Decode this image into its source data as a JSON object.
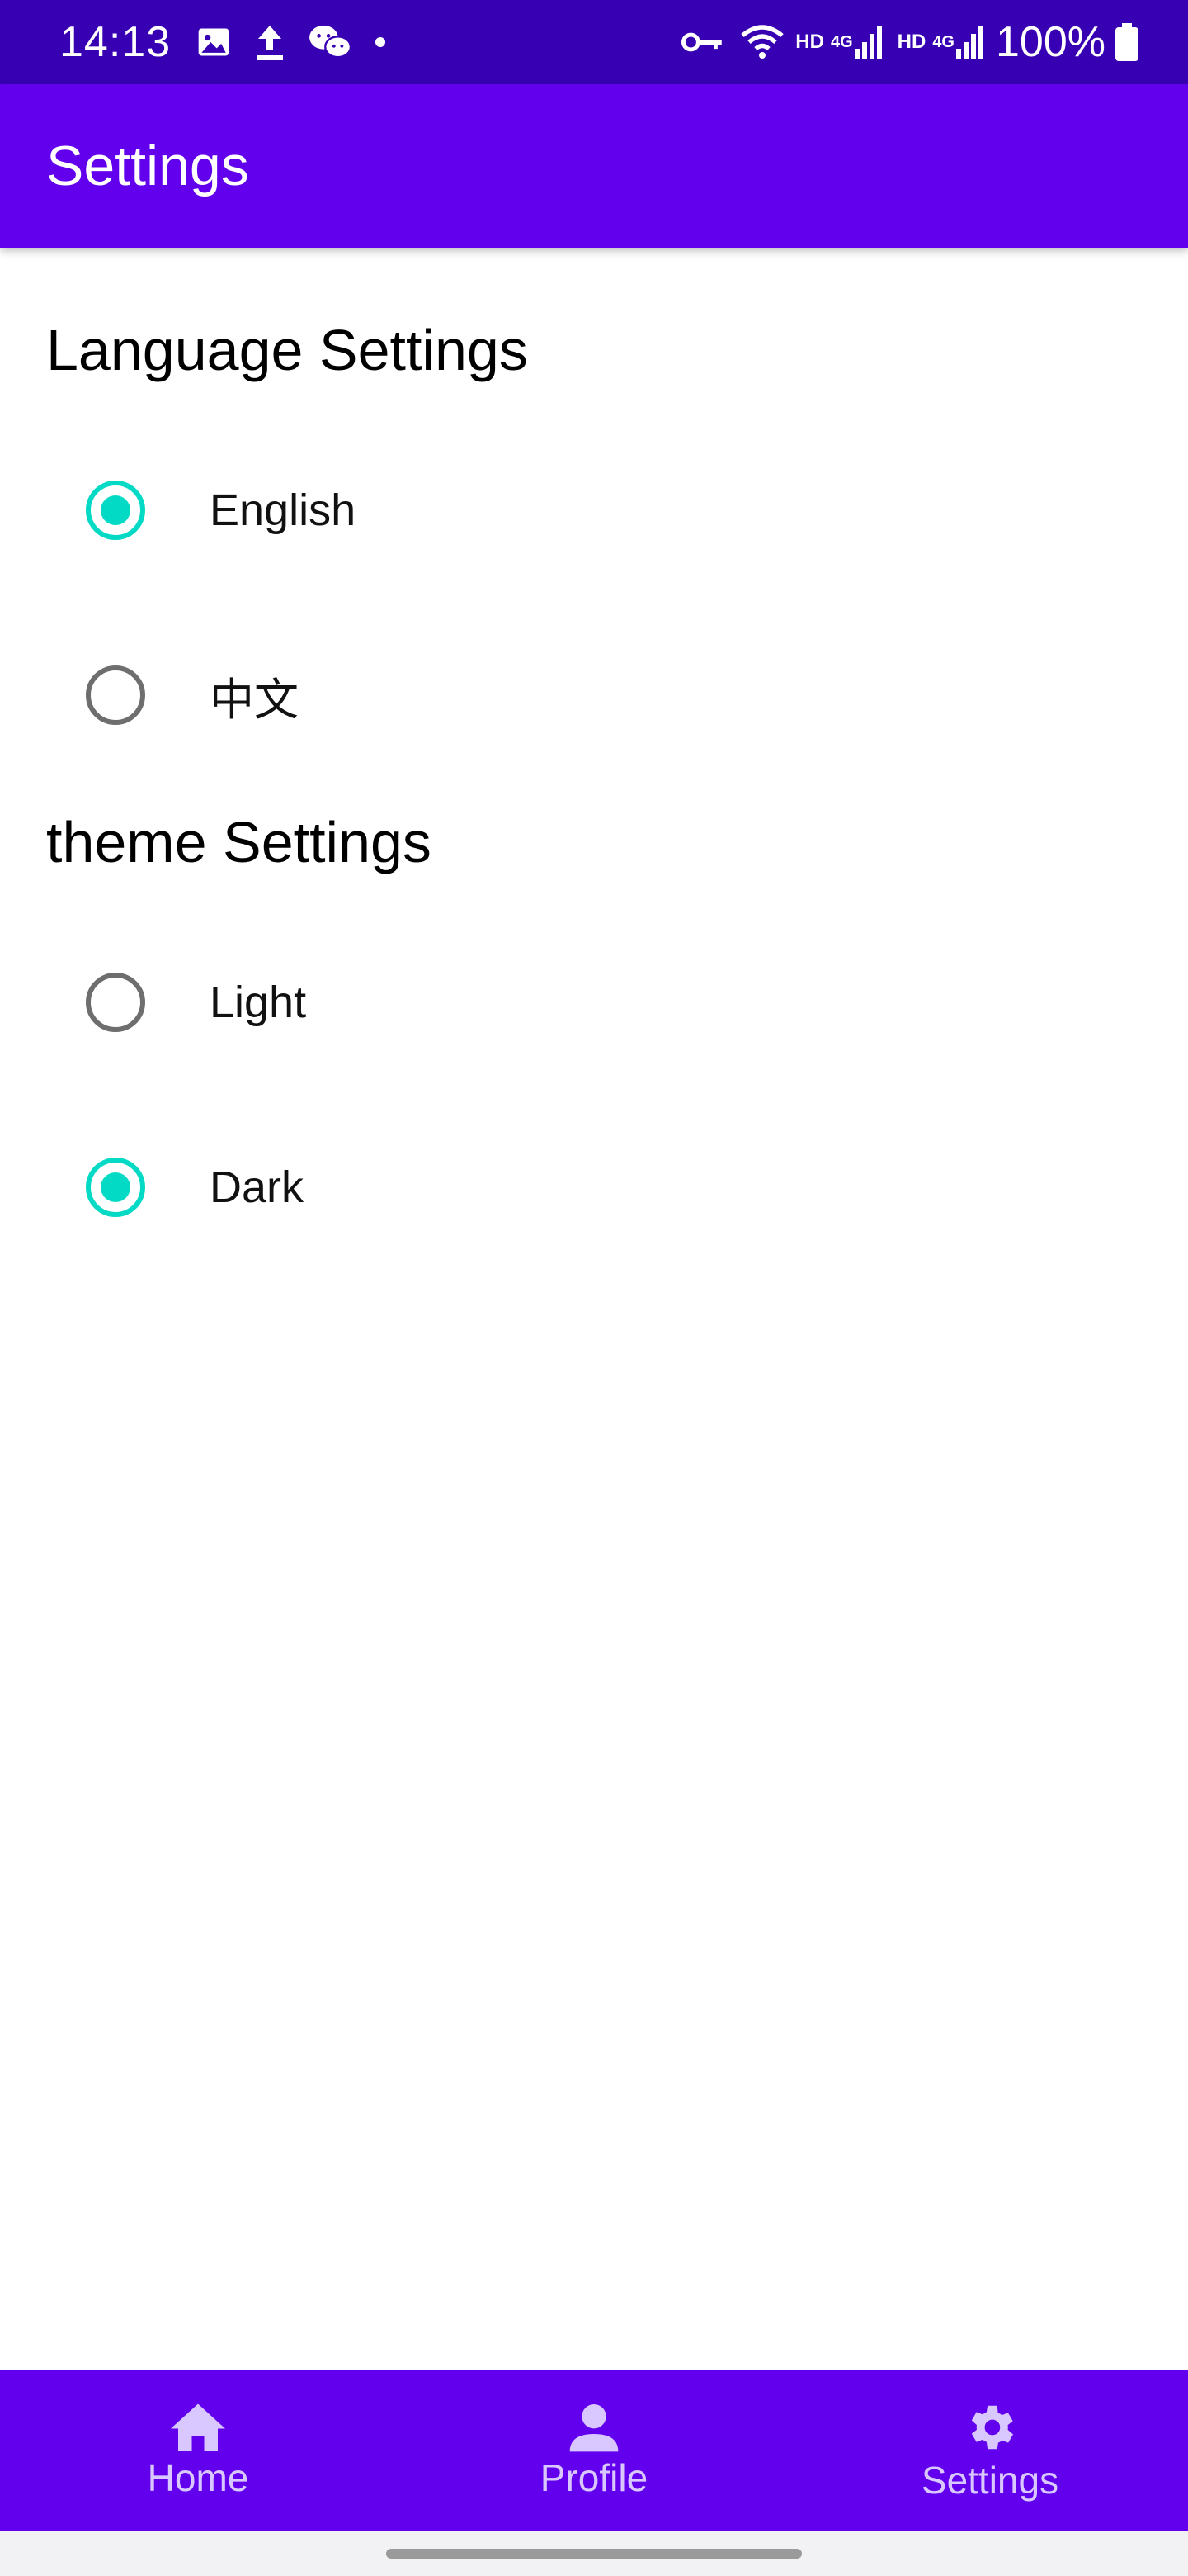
{
  "status_bar": {
    "time": "14:13",
    "net1_label": "HD",
    "net1_gen": "4G",
    "net2_label": "HD",
    "net2_gen": "4G",
    "battery": "100%",
    "icons": [
      "gallery-icon",
      "upload-icon",
      "wechat-icon",
      "dot-icon",
      "vpn-key-icon",
      "wifi-icon",
      "signal-icon",
      "signal-icon",
      "battery-icon"
    ]
  },
  "app_bar": {
    "title": "Settings"
  },
  "language": {
    "title": "Language Settings",
    "options": [
      {
        "label": "English",
        "checked": true
      },
      {
        "label": "中文",
        "checked": false
      }
    ]
  },
  "theme": {
    "title": "theme Settings",
    "options": [
      {
        "label": "Light",
        "checked": false
      },
      {
        "label": "Dark",
        "checked": true
      }
    ]
  },
  "bottom_nav": {
    "items": [
      {
        "label": "Home",
        "icon": "home-icon"
      },
      {
        "label": "Profile",
        "icon": "person-icon"
      },
      {
        "label": "Settings",
        "icon": "gear-icon"
      }
    ]
  },
  "colors": {
    "status_bar": "#3700b3",
    "primary": "#6200ee",
    "accent": "#03dac5",
    "nav_text": "#d9c7ff"
  }
}
